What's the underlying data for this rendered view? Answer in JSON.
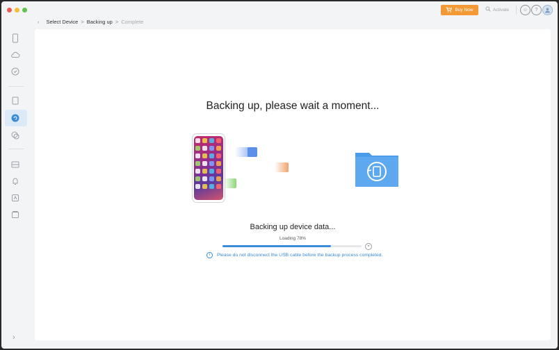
{
  "breadcrumb": {
    "back": "‹",
    "step1": "Select Device",
    "sep1": ">",
    "step2": "Backing up",
    "sep2": ">",
    "step3": "Complete"
  },
  "toolbar": {
    "buy_label": "Buy Now",
    "activate_label": "Activate"
  },
  "main": {
    "headline": "Backing up, please wait a moment...",
    "status": "Backing up device data...",
    "loading_label": "Loading 78%",
    "progress": 0.78,
    "notice": "Please do not disconnect the USB cable before the backup process completed."
  },
  "sidebar": {
    "items": [
      {
        "icon": "phone-icon"
      },
      {
        "icon": "cloud-icon"
      },
      {
        "icon": "sync-icon"
      },
      {
        "icon": "files-icon"
      },
      {
        "icon": "backup-icon",
        "active": true
      },
      {
        "icon": "messages-icon"
      },
      {
        "icon": "photos-icon"
      },
      {
        "icon": "ringtone-icon"
      },
      {
        "icon": "apps-icon"
      },
      {
        "icon": "toolbox-icon"
      }
    ],
    "expand": "›"
  },
  "colors": {
    "accent": "#3a8bd9",
    "buy": "#f39a37",
    "active_bg": "#dce9f8"
  }
}
